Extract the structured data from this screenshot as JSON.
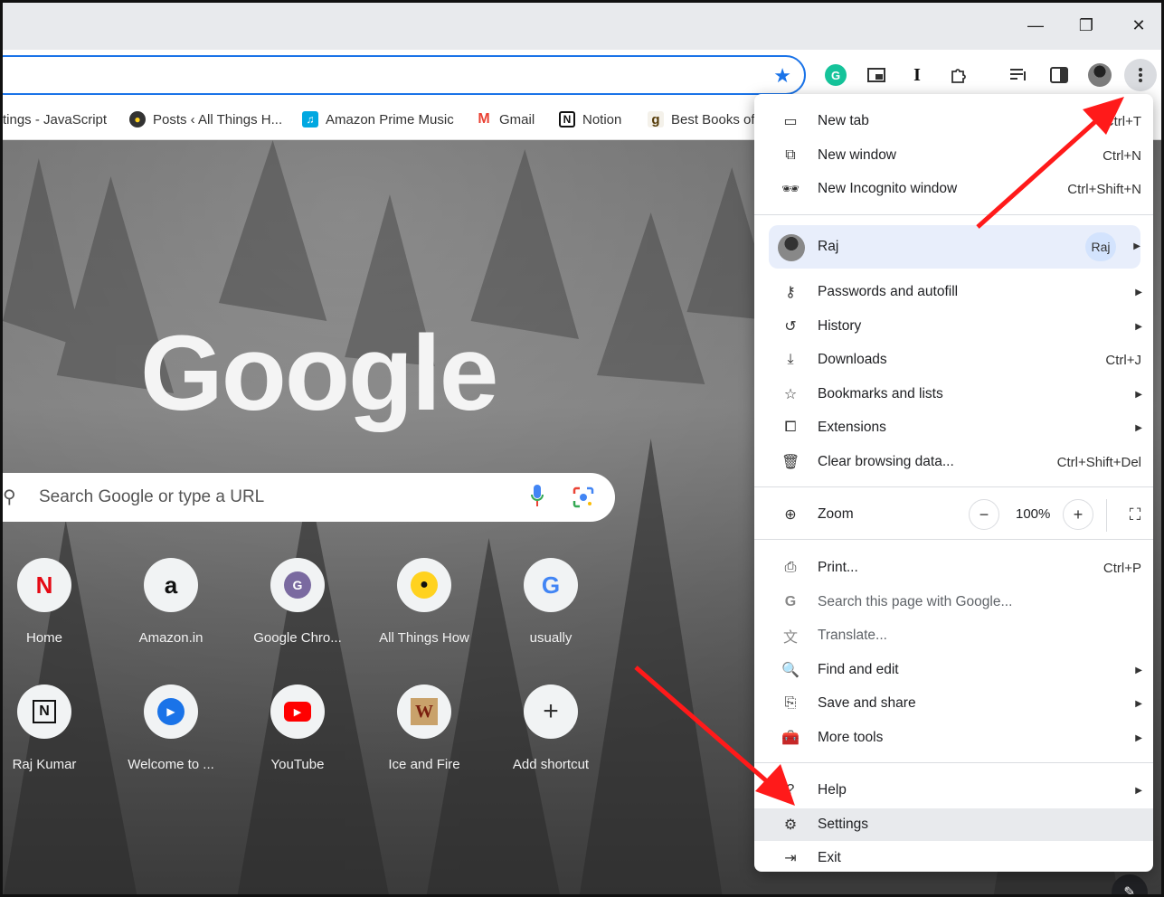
{
  "window": {
    "controls": [
      "—",
      "❐",
      "✕"
    ]
  },
  "bookmarks": [
    {
      "label": "tings - JavaScript",
      "icon": "bookmark-page-icon"
    },
    {
      "label": "Posts ‹ All Things H...",
      "icon": "bulb-icon"
    },
    {
      "label": "Amazon Prime Music",
      "icon": "music-icon"
    },
    {
      "label": "Gmail",
      "icon": "gmail-icon"
    },
    {
      "label": "Notion",
      "icon": "notion-icon"
    },
    {
      "label": "Best Books of",
      "icon": "goodreads-icon"
    }
  ],
  "ntp": {
    "logo_text": "Google",
    "search_placeholder": "Search Google or type a URL",
    "shortcuts": [
      {
        "label": "Home",
        "glyph": "N",
        "color": "#e50914"
      },
      {
        "label": "Amazon.in",
        "glyph": "a",
        "color": "#111111"
      },
      {
        "label": "Google Chro...",
        "glyph": "G",
        "color": "#7a6aa0"
      },
      {
        "label": "All Things How",
        "glyph": "💡",
        "color": "#111111"
      },
      {
        "label": "usually",
        "glyph": "G",
        "color": "#4285f4"
      },
      {
        "label": "Raj Kumar",
        "glyph": "N",
        "color": "#111111"
      },
      {
        "label": "Welcome to ...",
        "glyph": "▶",
        "color": "#1a73e8"
      },
      {
        "label": "YouTube",
        "glyph": "▶",
        "color": "#ff0000"
      },
      {
        "label": "Ice and Fire",
        "glyph": "W",
        "color": "#8b4513"
      },
      {
        "label": "Add shortcut",
        "glyph": "+",
        "color": "#333333"
      }
    ]
  },
  "menu": {
    "items": [
      {
        "label": "New tab",
        "shortcut": "Ctrl+T",
        "icon": "new-tab-icon"
      },
      {
        "label": "New window",
        "shortcut": "Ctrl+N",
        "icon": "new-window-icon"
      },
      {
        "label": "New Incognito window",
        "shortcut": "Ctrl+Shift+N",
        "icon": "incognito-icon"
      }
    ],
    "profile": {
      "name": "Raj",
      "pill": "Raj"
    },
    "items2": [
      {
        "label": "Passwords and autofill",
        "icon": "key-icon"
      },
      {
        "label": "History",
        "icon": "history-icon"
      },
      {
        "label": "Downloads",
        "shortcut": "Ctrl+J",
        "icon": "download-icon"
      },
      {
        "label": "Bookmarks and lists",
        "icon": "star-icon"
      },
      {
        "label": "Extensions",
        "icon": "puzzle-icon"
      },
      {
        "label": "Clear browsing data...",
        "shortcut": "Ctrl+Shift+Del",
        "icon": "trash-icon"
      }
    ],
    "zoom": {
      "label": "Zoom",
      "value": "100%",
      "minus": "−",
      "plus": "+"
    },
    "items3": [
      {
        "label": "Print...",
        "shortcut": "Ctrl+P",
        "icon": "print-icon"
      },
      {
        "label": "Search this page with Google...",
        "icon": "google-g-icon"
      },
      {
        "label": "Translate...",
        "icon": "translate-icon"
      },
      {
        "label": "Find and edit",
        "icon": "find-icon"
      },
      {
        "label": "Save and share",
        "icon": "save-icon"
      },
      {
        "label": "More tools",
        "icon": "toolbox-icon"
      }
    ],
    "items4": [
      {
        "label": "Help",
        "icon": "help-icon"
      },
      {
        "label": "Settings",
        "icon": "gear-icon"
      },
      {
        "label": "Exit",
        "icon": "exit-icon"
      }
    ]
  },
  "colors": {
    "accent": "#1a73e8",
    "annotation_arrow": "#ff1a1a"
  }
}
